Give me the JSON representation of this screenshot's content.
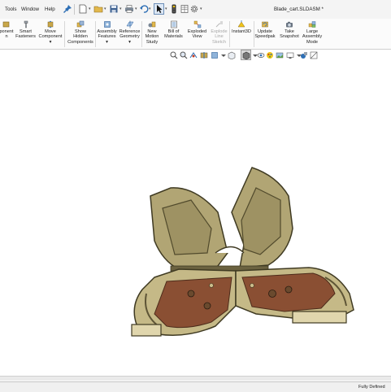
{
  "menu": {
    "items": [
      "Tools",
      "Window",
      "Help"
    ]
  },
  "document_title": "Blade_cart.SLDASM *",
  "ribbon": {
    "buttons": [
      {
        "line1": "ponent",
        "line2": "n",
        "line3": ""
      },
      {
        "line1": "Smart",
        "line2": "Fasteners",
        "line3": ""
      },
      {
        "line1": "Move",
        "line2": "Component",
        "line3": "▾"
      },
      {
        "line1": "Show",
        "line2": "Hidden",
        "line3": "Components"
      },
      {
        "line1": "Assembly",
        "line2": "Features",
        "line3": "▾"
      },
      {
        "line1": "Reference",
        "line2": "Geometry",
        "line3": "▾"
      },
      {
        "line1": "New",
        "line2": "Motion",
        "line3": "Study"
      },
      {
        "line1": "Bill of",
        "line2": "Materials",
        "line3": ""
      },
      {
        "line1": "Exploded",
        "line2": "View",
        "line3": ""
      },
      {
        "line1": "Explode",
        "line2": "Line",
        "line3": "Sketch"
      },
      {
        "line1": "Instant3D",
        "line2": "",
        "line3": ""
      },
      {
        "line1": "Update",
        "line2": "Speedpak",
        "line3": ""
      },
      {
        "line1": "Take",
        "line2": "Snapshot",
        "line3": ""
      },
      {
        "line1": "Large",
        "line2": "Assembly",
        "line3": "Mode"
      }
    ]
  },
  "status": {
    "text": "Fully Defined"
  },
  "colors": {
    "part_light": "#d9cfa6",
    "part_mid": "#a89c6e",
    "part_dark": "#5e5536",
    "copper": "#9a5a3c",
    "accent_blue": "#2e6fb5"
  }
}
